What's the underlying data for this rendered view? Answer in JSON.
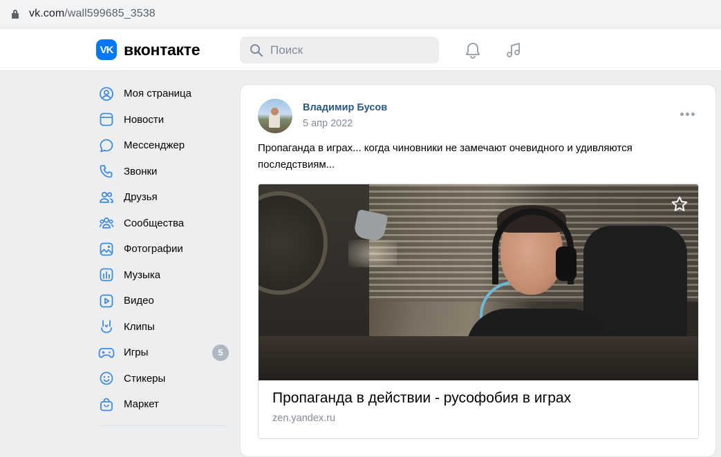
{
  "browser": {
    "url_host": "vk.com",
    "url_path": "/wall599685_3538"
  },
  "header": {
    "logo_mark": "VK",
    "logo_text": "вконтакте",
    "search_placeholder": "Поиск",
    "icons": [
      "bell-icon",
      "music-icon"
    ],
    "accent_color": "#0077ff"
  },
  "sidebar": {
    "items": [
      {
        "label": "Моя страница",
        "icon": "user-circle-icon"
      },
      {
        "label": "Новости",
        "icon": "newsfeed-icon"
      },
      {
        "label": "Мессенджер",
        "icon": "message-icon"
      },
      {
        "label": "Звонки",
        "icon": "phone-icon"
      },
      {
        "label": "Друзья",
        "icon": "friends-icon"
      },
      {
        "label": "Сообщества",
        "icon": "communities-icon"
      },
      {
        "label": "Фотографии",
        "icon": "photo-icon"
      },
      {
        "label": "Музыка",
        "icon": "music-bars-icon"
      },
      {
        "label": "Видео",
        "icon": "video-icon"
      },
      {
        "label": "Клипы",
        "icon": "clips-icon"
      },
      {
        "label": "Игры",
        "icon": "gamepad-icon",
        "badge": "5"
      },
      {
        "label": "Стикеры",
        "icon": "smile-icon"
      },
      {
        "label": "Маркет",
        "icon": "shopping-bag-icon"
      }
    ]
  },
  "post": {
    "author": "Владимир Бусов",
    "date": "5 апр 2022",
    "text": "Пропаганда в играх... когда чиновники не замечают очевидного и удивляются последствиям...",
    "link": {
      "title": "Пропаганда в действии - русофобия в играх",
      "domain": "zen.yandex.ru"
    }
  }
}
